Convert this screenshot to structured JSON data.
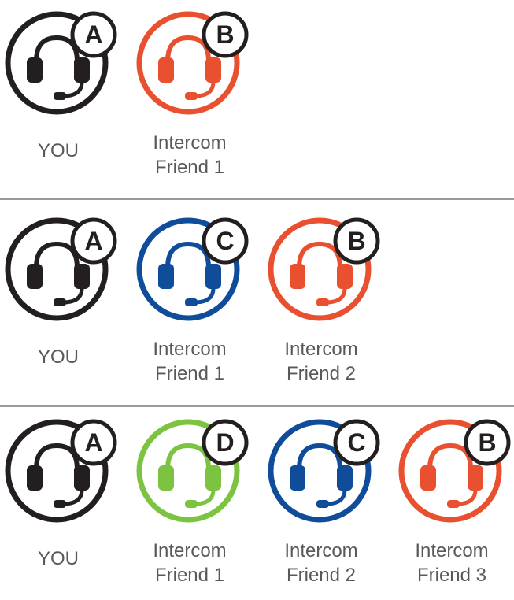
{
  "icon_types": {
    "headset": "headset-icon"
  },
  "colors": {
    "black": "#231f20",
    "orange": "#e9502f",
    "blue": "#0f4c9a",
    "green": "#7dc342",
    "label": "#58595b",
    "divider": "#9a9a9a"
  },
  "rows": [
    {
      "units": [
        {
          "letter": "A",
          "color": "black",
          "label_lines": [
            "YOU"
          ]
        },
        {
          "letter": "B",
          "color": "orange",
          "label_lines": [
            "Intercom",
            "Friend 1"
          ]
        }
      ]
    },
    {
      "units": [
        {
          "letter": "A",
          "color": "black",
          "label_lines": [
            "YOU"
          ]
        },
        {
          "letter": "C",
          "color": "blue",
          "label_lines": [
            "Intercom",
            "Friend 1"
          ]
        },
        {
          "letter": "B",
          "color": "orange",
          "label_lines": [
            "Intercom",
            "Friend 2"
          ]
        }
      ]
    },
    {
      "units": [
        {
          "letter": "A",
          "color": "black",
          "label_lines": [
            "YOU"
          ]
        },
        {
          "letter": "D",
          "color": "green",
          "label_lines": [
            "Intercom",
            "Friend 1"
          ]
        },
        {
          "letter": "C",
          "color": "blue",
          "label_lines": [
            "Intercom",
            "Friend 2"
          ]
        },
        {
          "letter": "B",
          "color": "orange",
          "label_lines": [
            "Intercom",
            "Friend 3"
          ]
        }
      ]
    }
  ]
}
